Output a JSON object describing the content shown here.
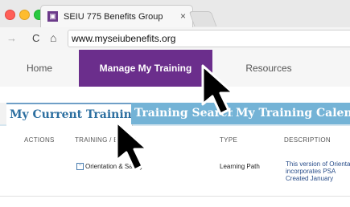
{
  "browser": {
    "tab_title": "SEIU 775 Benefits Group",
    "tab_close": "×",
    "url": "www.myseiubenefits.org",
    "back_glyph": "→",
    "reload_glyph": "C",
    "home_glyph": "⌂"
  },
  "site_nav": {
    "items": [
      {
        "label": "Home"
      },
      {
        "label": "Manage My Training",
        "active": true
      },
      {
        "label": "Resources"
      }
    ]
  },
  "page_tabs": [
    {
      "label": "My Current Training",
      "active": true
    },
    {
      "label": "Training Search"
    },
    {
      "label": "My Training Calendar"
    }
  ],
  "table": {
    "headers": [
      "ACTIONS",
      "TRAINING / EVENT",
      "TYPE",
      "DESCRIPTION"
    ],
    "rows": [
      {
        "actions": "",
        "training": "Orientation & Safety",
        "type": "Learning Path",
        "description": [
          "This version of Orientation",
          "incorporates PSA",
          "Created January"
        ]
      }
    ]
  },
  "icons": {
    "favicon": "seiu-favicon-icon",
    "expand": "collapse-toggle-icon",
    "cursor": "mouse-pointer-icon"
  },
  "colors": {
    "nav_active": "#6b2e8c",
    "tab_active_text": "#2c6fa0",
    "tab_inactive_bg": "#74b3d6"
  }
}
